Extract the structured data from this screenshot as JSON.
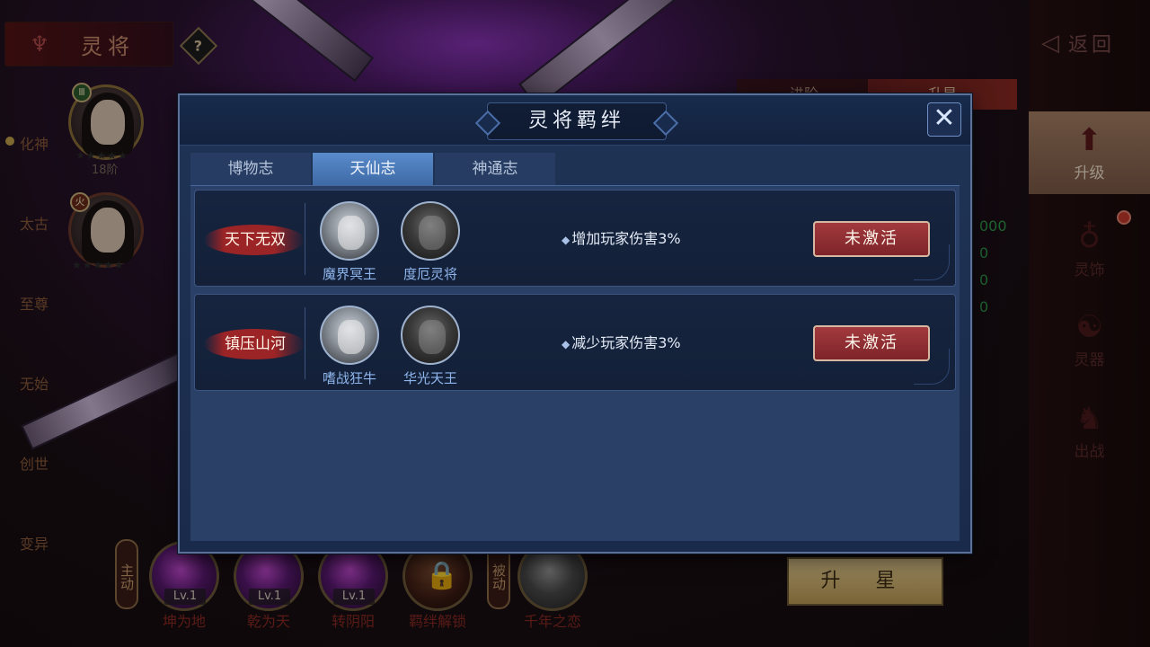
{
  "background": {
    "title": "灵将",
    "help_icon": "?",
    "tiers": [
      "化神",
      "太古",
      "至尊",
      "无始",
      "创世",
      "变异"
    ],
    "heroes": [
      {
        "badge": "Ⅲ",
        "caption": "18阶",
        "stars": "★★★★★"
      },
      {
        "badge": "火",
        "caption": "",
        "stars": "★★★★★"
      }
    ],
    "back_label": "返回",
    "right_nav": [
      {
        "label": "升级",
        "icon": "upgrade-icon",
        "active": true
      },
      {
        "label": "灵饰",
        "icon": "ornament-icon",
        "active": false
      },
      {
        "label": "灵器",
        "icon": "yinyang-icon",
        "active": false
      },
      {
        "label": "出战",
        "icon": "battle-icon",
        "active": false
      }
    ],
    "upgrade_tabs": [
      "进阶",
      "升星"
    ],
    "green_values": [
      "000",
      "0",
      "0",
      "0"
    ],
    "skills": {
      "active_tag": "主动",
      "passive_tag": "被动",
      "items": [
        {
          "name": "坤为地",
          "level": "Lv.1"
        },
        {
          "name": "乾为天",
          "level": "Lv.1"
        },
        {
          "name": "转阴阳",
          "level": "Lv.1"
        },
        {
          "name": "羁绊解锁",
          "level": ""
        },
        {
          "name": "千年之恋",
          "level": ""
        }
      ]
    },
    "star_up_button": "升 星"
  },
  "dialog": {
    "title": "灵将羁绊",
    "close_icon": "close-icon",
    "tabs": [
      "博物志",
      "天仙志",
      "神通志"
    ],
    "active_tab": "天仙志",
    "bonds": [
      {
        "name": "天下无双",
        "heroes": [
          "魔界冥王",
          "度厄灵将"
        ],
        "bonus": "增加玩家伤害3%",
        "status": "未激活"
      },
      {
        "name": "镇压山河",
        "heroes": [
          "嗜战狂牛",
          "华光天王"
        ],
        "bonus": "减少玩家伤害3%",
        "status": "未激活"
      }
    ]
  },
  "colors": {
    "dialog_bg": "#1f3456",
    "tab_active": "#4a7bbb",
    "status_button": "#8e2e33",
    "hero_label": "#8fb6ec"
  }
}
